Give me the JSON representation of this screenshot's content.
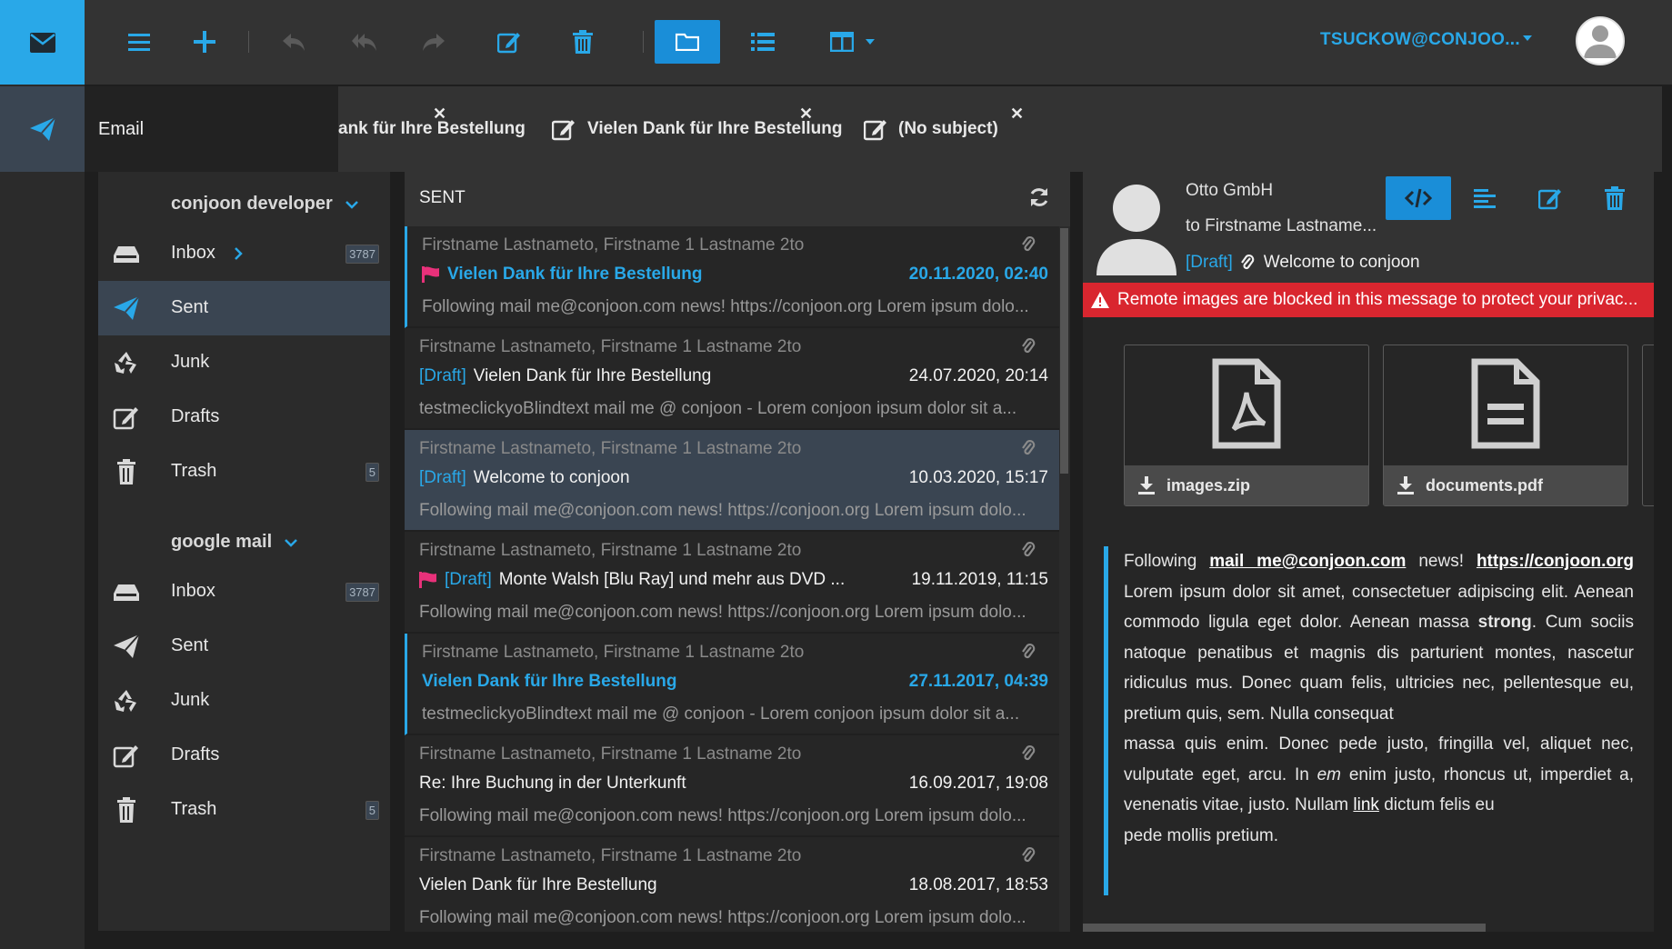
{
  "toolbar": {
    "account": "TSUCKOW@CONJOO...",
    "icons": [
      "menu-icon",
      "plus-icon",
      "reply-icon",
      "reply-all-icon",
      "forward-icon",
      "edit-icon",
      "trash-icon",
      "folder-icon",
      "list-icon",
      "columns-icon"
    ]
  },
  "tabs": {
    "email": "Email",
    "items": [
      {
        "label": "ank für Ihre Bestellung"
      },
      {
        "label": "Vielen Dank für Ihre Bestellung"
      },
      {
        "label": "(No subject)"
      }
    ]
  },
  "nav": {
    "groups": [
      {
        "name": "conjoon developer",
        "items": [
          {
            "label": "Inbox",
            "badge": "3787",
            "icon": "inbox-icon"
          },
          {
            "label": "Sent",
            "badge": "",
            "icon": "send-icon"
          },
          {
            "label": "Junk",
            "badge": "",
            "icon": "recycle-icon"
          },
          {
            "label": "Drafts",
            "badge": "",
            "icon": "edit-icon"
          },
          {
            "label": "Trash",
            "badge": "5",
            "icon": "trash-icon"
          }
        ]
      },
      {
        "name": "google mail",
        "items": [
          {
            "label": "Inbox",
            "badge": "3787",
            "icon": "inbox-icon"
          },
          {
            "label": "Sent",
            "badge": "",
            "icon": "send-icon"
          },
          {
            "label": "Junk",
            "badge": "",
            "icon": "recycle-icon"
          },
          {
            "label": "Drafts",
            "badge": "",
            "icon": "edit-icon"
          },
          {
            "label": "Trash",
            "badge": "5",
            "icon": "trash-icon"
          }
        ]
      }
    ]
  },
  "list": {
    "title": "SENT",
    "rows": [
      {
        "from": "Firstname Lastnameto, Firstname 1 Lastname 2to",
        "draft": "",
        "flag": true,
        "subject": "Vielen Dank für Ihre Bestellung",
        "date": "20.11.2020, 02:40",
        "preview": "Following mail me@conjoon.com news! https://conjoon.org Lorem ipsum dolo...",
        "unread": true
      },
      {
        "from": "Firstname Lastnameto, Firstname 1 Lastname 2to",
        "draft": "[Draft]",
        "flag": false,
        "subject": "Vielen Dank für Ihre Bestellung",
        "date": "24.07.2020, 20:14",
        "preview": "testmeclickyoBlindtext mail me @ conjoon - Lorem conjoon ipsum dolor sit a...",
        "unread": false
      },
      {
        "from": "Firstname Lastnameto, Firstname 1 Lastname 2to",
        "draft": "[Draft]",
        "flag": false,
        "subject": "Welcome to conjoon",
        "date": "10.03.2020, 15:17",
        "preview": "Following mail me@conjoon.com news! https://conjoon.org Lorem ipsum dolo...",
        "unread": false
      },
      {
        "from": "Firstname Lastnameto, Firstname 1 Lastname 2to",
        "draft": "[Draft]",
        "flag": true,
        "subject": "Monte Walsh [Blu Ray] und mehr aus DVD ...",
        "date": "19.11.2019, 11:15",
        "preview": "Following mail me@conjoon.com news! https://conjoon.org Lorem ipsum dolo...",
        "unread": false
      },
      {
        "from": "Firstname Lastnameto, Firstname 1 Lastname 2to",
        "draft": "",
        "flag": false,
        "subject": "Vielen Dank für Ihre Bestellung",
        "date": "27.11.2017, 04:39",
        "preview": "testmeclickyoBlindtext mail me @ conjoon - Lorem conjoon ipsum dolor sit a...",
        "unread": true
      },
      {
        "from": "Firstname Lastnameto, Firstname 1 Lastname 2to",
        "draft": "",
        "flag": false,
        "subject": "Re: Ihre Buchung in der Unterkunft",
        "date": "16.09.2017, 19:08",
        "preview": "Following mail me@conjoon.com news! https://conjoon.org Lorem ipsum dolo...",
        "unread": false
      },
      {
        "from": "Firstname Lastnameto, Firstname 1 Lastname 2to",
        "draft": "",
        "flag": false,
        "subject": "Vielen Dank für Ihre Bestellung",
        "date": "18.08.2017, 18:53",
        "preview": "Following mail me@conjoon.com news! https://conjoon.org Lorem ipsum dolo...",
        "unread": false
      }
    ]
  },
  "reader": {
    "from": "Otto GmbH",
    "to": "to Firstname Lastname...",
    "draft": "[Draft]",
    "subject": "Welcome to conjoon",
    "warning": "Remote images are blocked in this message to protect your privac...",
    "attachments": [
      {
        "name": "images.zip",
        "icon": "pdf-file-icon"
      },
      {
        "name": "documents.pdf",
        "icon": "text-file-icon"
      }
    ],
    "body": {
      "p1": "Following",
      "link1": "mail me@conjoon.com",
      "p2": "news!",
      "link2": "https://conjoon.org",
      "p3": "Lorem ipsum dolor sit amet, consectetuer adipiscing elit. Aenean commodo ligula eget dolor. Aenean massa",
      "strong": "strong",
      "p4": ". Cum sociis natoque penatibus et magnis dis parturient montes, nascetur ridiculus mus. Donec quam felis, ultricies nec, pellentesque eu, pretium quis, sem. Nulla consequat",
      "p5": "massa quis enim. Donec pede justo, fringilla vel, aliquet nec, vulputate eget, arcu. In",
      "em": "em",
      "p6": "enim justo, rhoncus ut, imperdiet a, venenatis vitae, justo. Nullam",
      "link3": "link",
      "p7": "dictum felis eu",
      "p8": "pede mollis pretium."
    }
  },
  "colors": {
    "accent": "#29a8e8",
    "selected": "#3a4552",
    "warning": "#d9262f",
    "flag": "#e8317a"
  }
}
